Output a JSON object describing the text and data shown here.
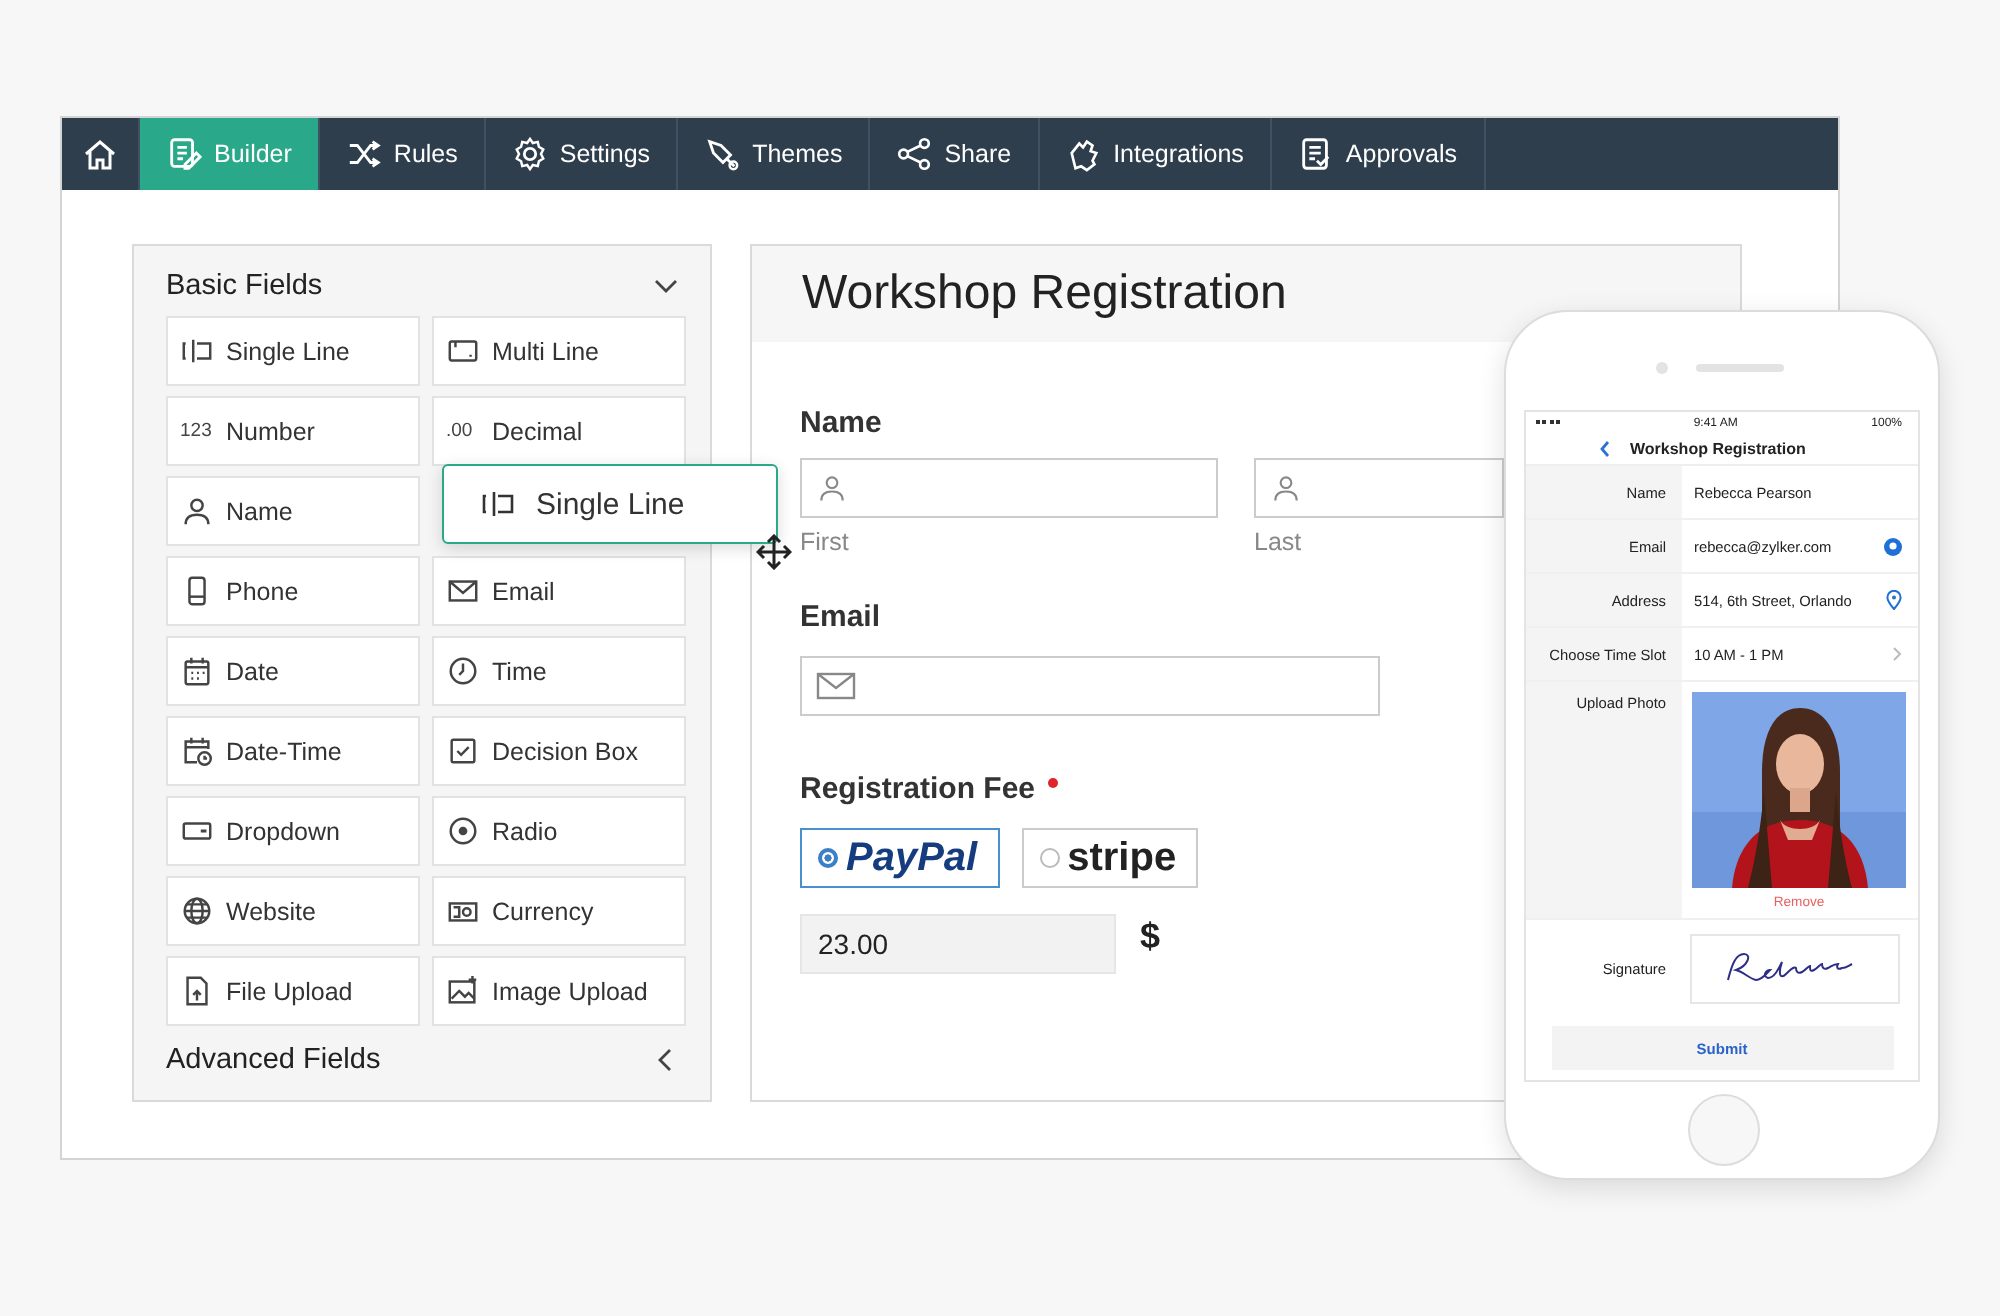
{
  "nav": {
    "tabs": [
      {
        "label": "Builder",
        "selected": true
      },
      {
        "label": "Rules",
        "selected": false
      },
      {
        "label": "Settings",
        "selected": false
      },
      {
        "label": "Themes",
        "selected": false
      },
      {
        "label": "Share",
        "selected": false
      },
      {
        "label": "Integrations",
        "selected": false
      },
      {
        "label": "Approvals",
        "selected": false
      }
    ]
  },
  "palette": {
    "sections": [
      {
        "title": "Basic Fields",
        "expanded": true,
        "fields": [
          {
            "label": "Single Line"
          },
          {
            "label": "Multi Line"
          },
          {
            "label": "Number",
            "icon_text": "123"
          },
          {
            "label": "Decimal",
            "icon_text": ".00"
          },
          {
            "label": "Name"
          },
          {
            "label": "Phone"
          },
          {
            "label": "Email"
          },
          {
            "label": "Date"
          },
          {
            "label": "Time"
          },
          {
            "label": "Date-Time"
          },
          {
            "label": "Decision Box"
          },
          {
            "label": "Dropdown"
          },
          {
            "label": "Radio"
          },
          {
            "label": "Website"
          },
          {
            "label": "Currency"
          },
          {
            "label": "File Upload"
          },
          {
            "label": "Image Upload"
          }
        ]
      },
      {
        "title": "Advanced Fields",
        "expanded": false
      }
    ],
    "dragging": {
      "label": "Single Line"
    }
  },
  "form": {
    "title": "Workshop Registration",
    "name": {
      "label": "Name",
      "parts": [
        "First",
        "Last"
      ]
    },
    "email": {
      "label": "Email"
    },
    "fee": {
      "label": "Registration Fee",
      "required": true,
      "options": [
        {
          "label": "PayPal",
          "selected": true
        },
        {
          "label": "stripe",
          "selected": false
        }
      ],
      "amount": "23.00",
      "currency": "$"
    }
  },
  "phone": {
    "time": "9:41 AM",
    "battery": "100%",
    "title": "Workshop Registration",
    "rows": [
      {
        "label": "Name",
        "value": "Rebecca Pearson",
        "kind": "text"
      },
      {
        "label": "Email",
        "value": "rebecca@zylker.com",
        "kind": "email"
      },
      {
        "label": "Address",
        "value": "514, 6th Street, Orlando",
        "kind": "location"
      },
      {
        "label": "Choose Time Slot",
        "value": "10 AM - 1 PM",
        "kind": "select"
      }
    ],
    "photo": {
      "label": "Upload Photo",
      "remove": "Remove"
    },
    "signature": {
      "label": "Signature"
    },
    "submit": "Submit"
  }
}
